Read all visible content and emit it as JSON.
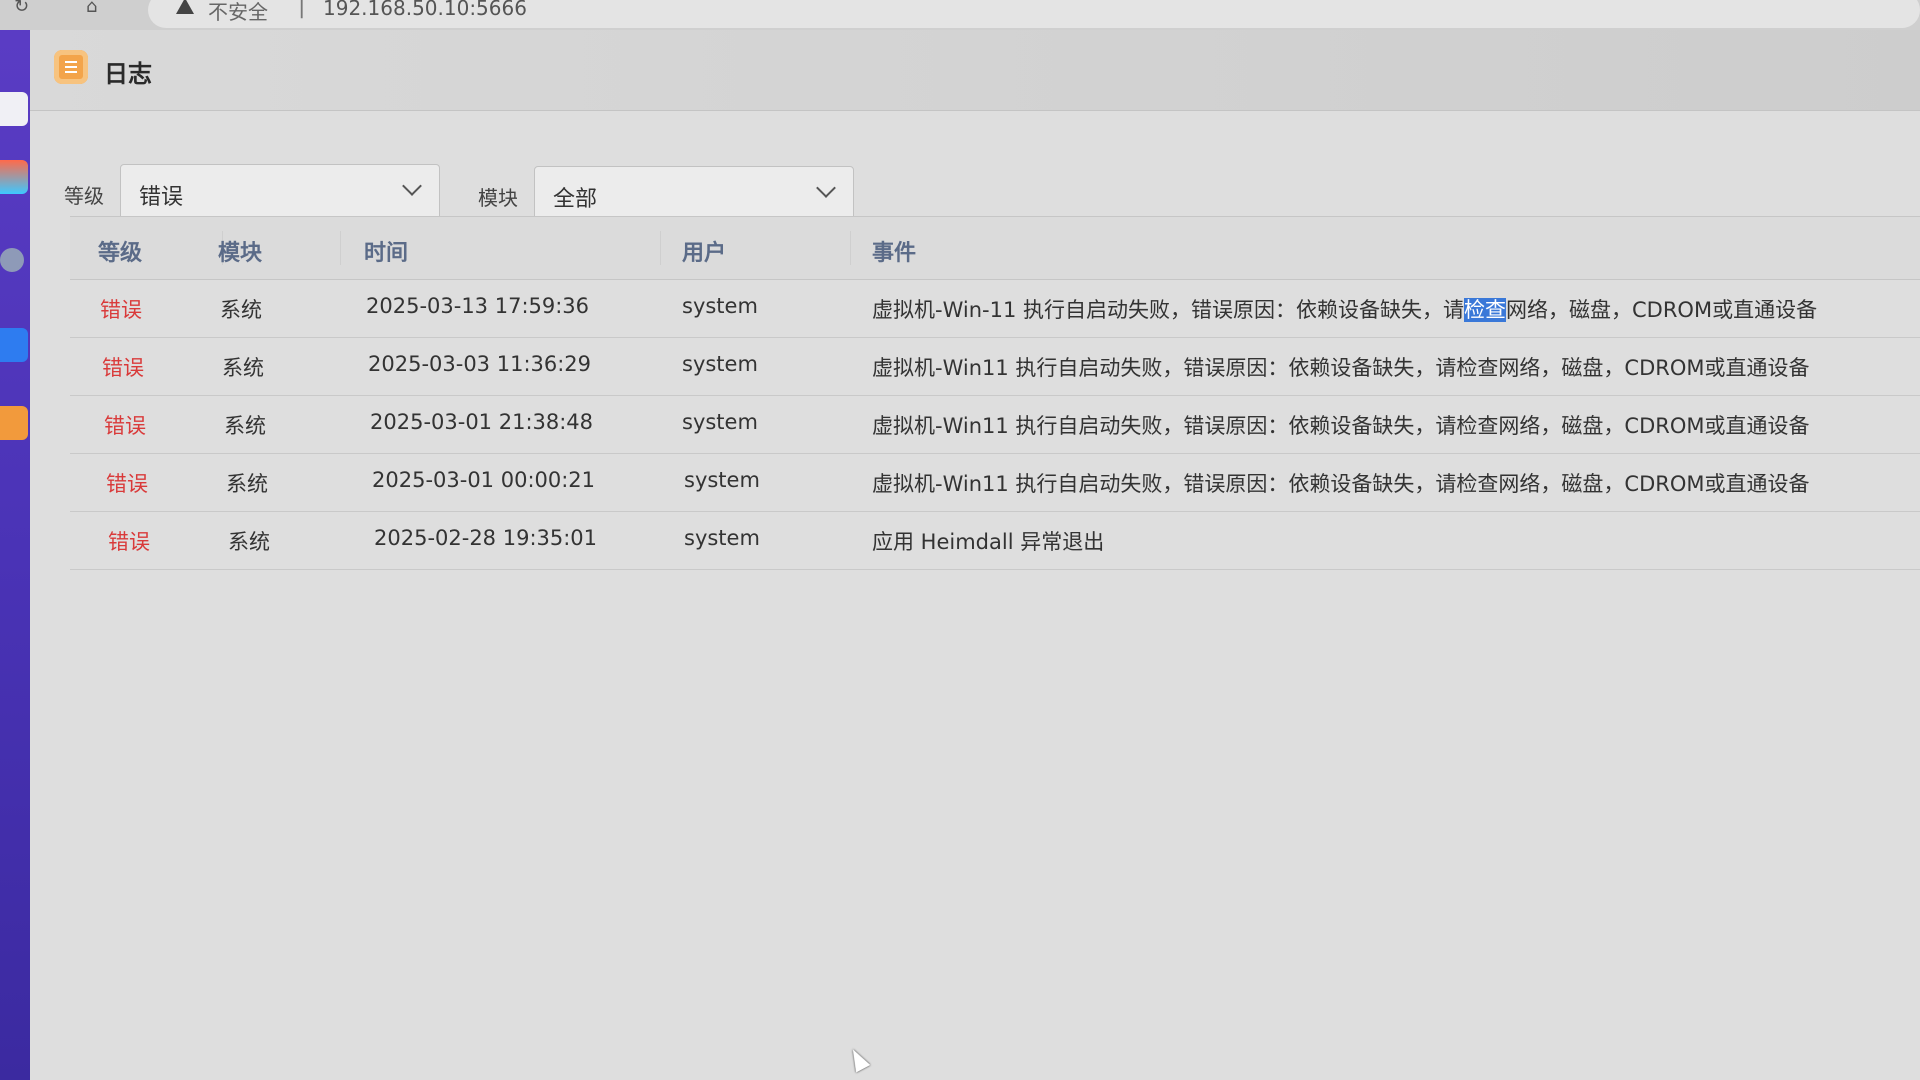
{
  "browser": {
    "nav_icons": [
      "reload-icon",
      "home-icon"
    ],
    "security_text": "不安全",
    "separator": "|",
    "url": "192.168.50.10:5666"
  },
  "app": {
    "title": "日志",
    "icon": "log-icon",
    "accent_color": "#f3a44a"
  },
  "filters": {
    "level": {
      "label": "等级",
      "value": "错误"
    },
    "module": {
      "label": "模块",
      "value": "全部"
    }
  },
  "table": {
    "headers": {
      "level": "等级",
      "module": "模块",
      "time": "时间",
      "user": "用户",
      "event": "事件"
    },
    "rows": [
      {
        "level": "错误",
        "module": "系统",
        "time": "2025-03-13 17:59:36",
        "user": "system",
        "event_before": "虚拟机-Win-11 执行自启动失败，错误原因：依赖设备缺失，请",
        "event_highlight": "检查",
        "event_after": "网络，磁盘，CDROM或直通设备"
      },
      {
        "level": "错误",
        "module": "系统",
        "time": "2025-03-03 11:36:29",
        "user": "system",
        "event": "虚拟机-Win11 执行自启动失败，错误原因：依赖设备缺失，请检查网络，磁盘，CDROM或直通设备"
      },
      {
        "level": "错误",
        "module": "系统",
        "time": "2025-03-01 21:38:48",
        "user": "system",
        "event": "虚拟机-Win11 执行自启动失败，错误原因：依赖设备缺失，请检查网络，磁盘，CDROM或直通设备"
      },
      {
        "level": "错误",
        "module": "系统",
        "time": "2025-03-01 00:00:21",
        "user": "system",
        "event": "虚拟机-Win11 执行自启动失败，错误原因：依赖设备缺失，请检查网络，磁盘，CDROM或直通设备"
      },
      {
        "level": "错误",
        "module": "系统",
        "time": "2025-02-28 19:35:01",
        "user": "system",
        "event": "应用 Heimdall 异常退出"
      }
    ]
  },
  "colors": {
    "error_text": "#d93a3a",
    "header_text": "#5b6b88",
    "dock": "#4a33b6",
    "selection": "#3a78d8"
  }
}
